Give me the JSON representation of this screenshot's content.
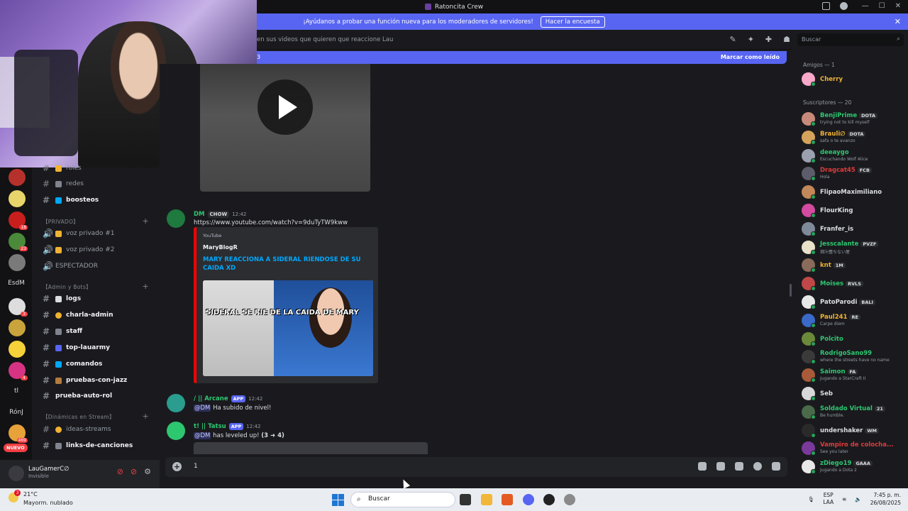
{
  "window": {
    "title": "Ratoncita Crew"
  },
  "banner": {
    "text": "¡Ayúdanos a probar una función nueva para los moderadores de servidores!",
    "button": "Hacer la encuesta"
  },
  "header": {
    "topic": "en sus videos que quieren que reaccione Lau",
    "search_placeholder": "Buscar"
  },
  "unread": {
    "left": "3",
    "mark_read": "Marcar como leído"
  },
  "servers": {
    "badges": [
      "18",
      "23",
      "1",
      "3",
      "4",
      "469"
    ],
    "esdm": "EsdM",
    "tl": "tl",
    "ronj": "RónJ",
    "nuevo": "NUEVO"
  },
  "channels": {
    "items": [
      {
        "label": "roles"
      },
      {
        "label": "redes"
      },
      {
        "label": "boosteos"
      },
      {
        "label": "voz privado #1"
      },
      {
        "label": "voz privado #2"
      },
      {
        "label": "ESPECTADOR"
      },
      {
        "label": "logs"
      },
      {
        "label": "charla-admin"
      },
      {
        "label": "staff"
      },
      {
        "label": "top-lauarmy"
      },
      {
        "label": "comandos"
      },
      {
        "label": "pruebas-con-jazz"
      },
      {
        "label": "prueba-auto-rol"
      },
      {
        "label": "ideas-streams"
      },
      {
        "label": "links-de-canciones"
      }
    ],
    "categories": [
      "【PRIVADO】",
      "【Admin y Bots】",
      "【Dinámicas en Stream】"
    ]
  },
  "user": {
    "name": "LauGamerC∅",
    "status": "Invisible"
  },
  "messages": {
    "dm": {
      "author": "DM",
      "tag": "CHOW",
      "time": "12:42",
      "link": "https://www.youtube.com/watch?v=9duTyTW9kww"
    },
    "embed": {
      "provider": "YouTube",
      "author": "MaryBlogR",
      "title": "MARY REACCIONA A SIDERAL RIENDOSE DE SU CAIDA XD",
      "caption": "SIDERAL SE RIE DE LA CAIDA DE MARY"
    },
    "arcane": {
      "author": "/ || Arcane",
      "app": "APP",
      "time": "12:42",
      "mention": "@DM",
      "text": "Ha subido de nivel!"
    },
    "tatsu": {
      "author": "t! || Tatsu",
      "app": "APP",
      "time": "12:42",
      "mention": "@DM",
      "text": "has leveled up!",
      "level": "(3 ➜ 4)"
    }
  },
  "input": {
    "value": "1"
  },
  "members": {
    "friends_header": "Amigos — 1",
    "subs_header": "Suscriptores — 20",
    "friends": [
      {
        "name": "Cherry",
        "color": "#f0b232"
      }
    ],
    "subs": [
      {
        "name": "BenjiPrime",
        "tag": "DOTA",
        "status": "trying not to kill myself",
        "color": "#2dc770"
      },
      {
        "name": "Brauli∅",
        "tag": "DOTA",
        "status": "safa o te avanzo",
        "color": "#f0b232"
      },
      {
        "name": "deeaygo",
        "status": "Escuchando Wolf Alice",
        "color": "#2dc770"
      },
      {
        "name": "Dragcat45",
        "tag": "FCB",
        "status": "Hola",
        "color": "#e03b3b"
      },
      {
        "name": "FlipaoMaximiliano",
        "color": "#dbdee1"
      },
      {
        "name": "FlourKing",
        "color": "#dbdee1"
      },
      {
        "name": "Franfer_is",
        "color": "#dbdee1"
      },
      {
        "name": "Jesscalante",
        "tag": "PVZF",
        "status": "畑汁塵ちない屋",
        "color": "#2dc770"
      },
      {
        "name": "knt",
        "tag": "1M",
        "color": "#f0b232"
      },
      {
        "name": "Moises",
        "tag": "RVLS",
        "color": "#2dc770"
      },
      {
        "name": "PatoParodi",
        "tag": "BALI",
        "color": "#dbdee1"
      },
      {
        "name": "Paul241",
        "tag": "RE",
        "status": "Carpe diem",
        "color": "#f0b232"
      },
      {
        "name": "Polcito",
        "color": "#2dc770"
      },
      {
        "name": "RodrigoSano99",
        "status": "where the streets have no name",
        "color": "#2dc770"
      },
      {
        "name": "Saimon",
        "tag": "FA",
        "status": "Jugando a StarCraft II",
        "color": "#2dc770"
      },
      {
        "name": "Seb",
        "color": "#dbdee1"
      },
      {
        "name": "Soldado Virtual",
        "tag": "21",
        "status": "Be humble.",
        "color": "#2dc770"
      },
      {
        "name": "undershaker",
        "tag": "WM",
        "color": "#dbdee1"
      },
      {
        "name": "Vampiro de colocha...",
        "status": "See you later",
        "color": "#e03b3b"
      },
      {
        "name": "zDiego19",
        "tag": "GAAA",
        "status": "Jugando a Dota 2",
        "color": "#2dc770"
      }
    ]
  },
  "taskbar": {
    "weather_temp": "21°C",
    "weather_cond": "Mayorm. nublado",
    "weather_badge": "3",
    "search": "Buscar",
    "lang": "ESP",
    "region": "LAA",
    "time": "7:45 p. m.",
    "date": "26/08/2025"
  }
}
